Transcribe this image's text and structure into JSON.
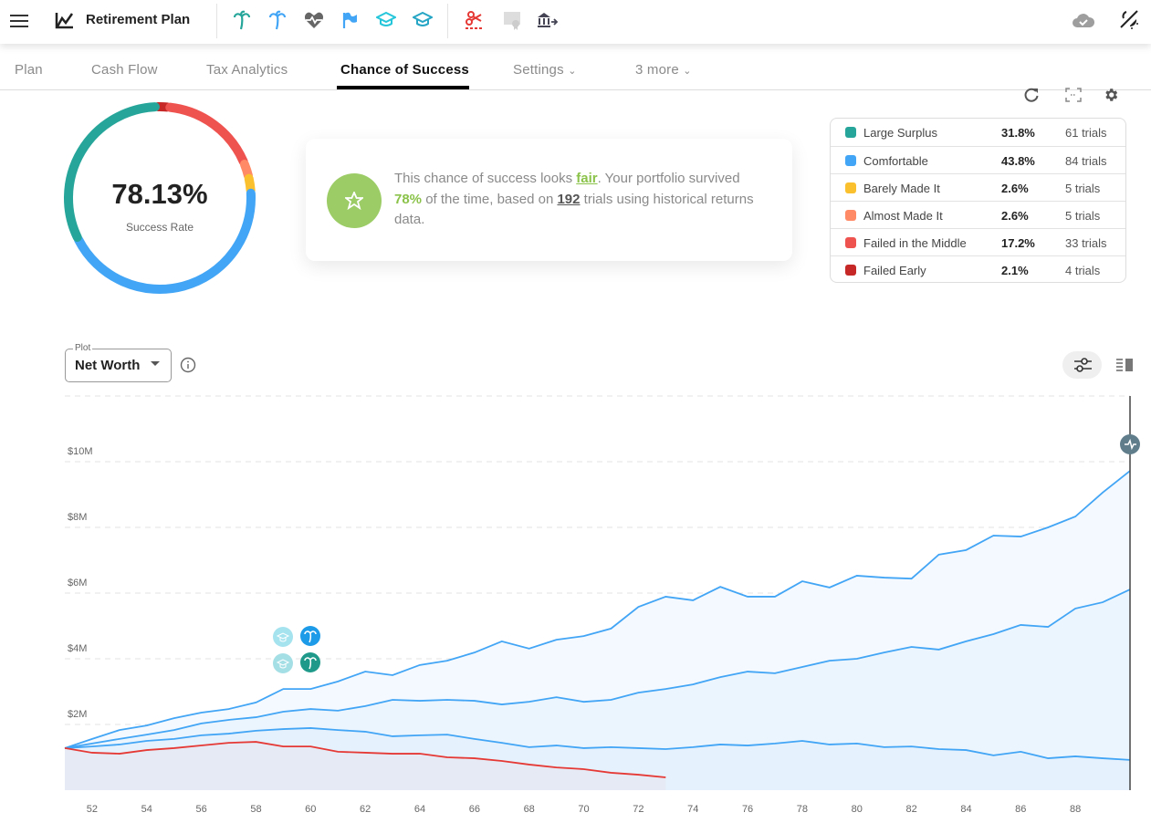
{
  "header": {
    "title": "Retirement Plan",
    "icons": [
      "menu-icon",
      "chart-logo-icon",
      "palm-tree-icon",
      "palm-tree-icon",
      "heartbeat-icon",
      "flag-icon",
      "graduation-cap-icon",
      "graduation-cap-icon",
      "scissors-icon",
      "certificate-icon",
      "bank-transfer-icon",
      "cloud-check-icon",
      "theme-toggle-icon"
    ]
  },
  "tabs": [
    {
      "label": "Plan"
    },
    {
      "label": "Cash Flow"
    },
    {
      "label": "Tax Analytics"
    },
    {
      "label": "Chance of Success",
      "active": true
    },
    {
      "label": "Settings"
    },
    {
      "label": "3 more"
    }
  ],
  "toolbar_icons": [
    "refresh-icon",
    "fullscreen-icon",
    "gear-icon"
  ],
  "donut": {
    "value": "78.13%",
    "label": "Success Rate"
  },
  "summary": {
    "p1": "This chance of success looks ",
    "rating": "fair",
    "p2": ". Your portfolio survived ",
    "pct": "78%",
    "p3": " of the time, based on ",
    "trials": "192",
    "p4": " trials using historical returns data.",
    "rating_color": "#8bc34a"
  },
  "outcomes": [
    {
      "name": "Large Surplus",
      "pct": "31.8%",
      "trials": "61 trials",
      "color": "#26a69a",
      "value": 31.8
    },
    {
      "name": "Comfortable",
      "pct": "43.8%",
      "trials": "84 trials",
      "color": "#42a5f5",
      "value": 43.8
    },
    {
      "name": "Barely Made It",
      "pct": "2.6%",
      "trials": "5 trials",
      "color": "#fbc02d",
      "value": 2.6
    },
    {
      "name": "Almost Made It",
      "pct": "2.6%",
      "trials": "5 trials",
      "color": "#ff8a65",
      "value": 2.6
    },
    {
      "name": "Failed in the Middle",
      "pct": "17.2%",
      "trials": "33 trials",
      "color": "#ef5350",
      "value": 17.2
    },
    {
      "name": "Failed Early",
      "pct": "2.1%",
      "trials": "4 trials",
      "color": "#c62828",
      "value": 2.1
    }
  ],
  "plot": {
    "label": "Plot",
    "value": "Net Worth"
  },
  "chart_data": {
    "type": "area",
    "xlim": [
      51,
      90
    ],
    "ylim": [
      0,
      12
    ],
    "x_ticks": [
      "52",
      "54",
      "56",
      "58",
      "60",
      "62",
      "64",
      "66",
      "68",
      "70",
      "72",
      "74",
      "76",
      "78",
      "80",
      "82",
      "84",
      "86",
      "88"
    ],
    "y_ticks": [
      {
        "v": 2,
        "label": "$2M"
      },
      {
        "v": 4,
        "label": "$4M"
      },
      {
        "v": 6,
        "label": "$6M"
      },
      {
        "v": 8,
        "label": "$8M"
      },
      {
        "v": 10,
        "label": "$10M"
      }
    ],
    "grid": true,
    "x_start": 51,
    "series": [
      {
        "color": "#42a5f5",
        "values": [
          1.28,
          1.56,
          1.83,
          1.97,
          2.19,
          2.36,
          2.47,
          2.67,
          3.08,
          3.08,
          3.31,
          3.61,
          3.5,
          3.81,
          3.94,
          4.19,
          4.53,
          4.31,
          4.58,
          4.69,
          4.92,
          5.58,
          5.89,
          5.78,
          6.19,
          5.89,
          5.89,
          6.36,
          6.17,
          6.53,
          6.47,
          6.44,
          7.17,
          7.31,
          7.75,
          7.72,
          8.0,
          8.33,
          9.06,
          9.72
        ]
      },
      {
        "color": "#42a5f5",
        "values": [
          1.28,
          1.42,
          1.56,
          1.69,
          1.83,
          2.03,
          2.14,
          2.22,
          2.39,
          2.47,
          2.42,
          2.56,
          2.75,
          2.72,
          2.75,
          2.72,
          2.61,
          2.69,
          2.83,
          2.69,
          2.75,
          2.97,
          3.08,
          3.22,
          3.44,
          3.61,
          3.56,
          3.75,
          3.94,
          4.0,
          4.19,
          4.36,
          4.28,
          4.53,
          4.75,
          5.03,
          4.97,
          5.53,
          5.72,
          6.11
        ]
      },
      {
        "color": "#42a5f5",
        "values": [
          1.28,
          1.33,
          1.39,
          1.5,
          1.56,
          1.67,
          1.72,
          1.81,
          1.86,
          1.89,
          1.83,
          1.78,
          1.64,
          1.67,
          1.69,
          1.56,
          1.44,
          1.31,
          1.36,
          1.28,
          1.31,
          1.28,
          1.25,
          1.31,
          1.39,
          1.36,
          1.42,
          1.5,
          1.39,
          1.42,
          1.31,
          1.33,
          1.25,
          1.22,
          1.06,
          1.17,
          0.97,
          1.03,
          0.97,
          0.92
        ]
      },
      {
        "color": "#e53935",
        "values": [
          1.28,
          1.14,
          1.11,
          1.22,
          1.28,
          1.36,
          1.44,
          1.47,
          1.33,
          1.33,
          1.17,
          1.14,
          1.11,
          1.11,
          1.0,
          0.97,
          0.89,
          0.78,
          0.69,
          0.64,
          0.53,
          0.47,
          0.39
        ]
      }
    ],
    "event_markers": [
      {
        "age": 59,
        "icon": "graduation-cap-icon"
      },
      {
        "age": 60,
        "icon": "palm-tree-icon"
      }
    ],
    "end_marker_icon": "heartbeat-icon"
  }
}
